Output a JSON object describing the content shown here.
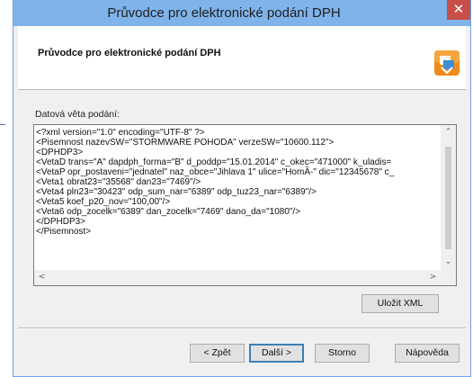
{
  "window": {
    "title": "Průvodce pro elektronické podání DPH",
    "close_glyph": "✕"
  },
  "header": {
    "title": "Průvodce pro elektronické podání DPH",
    "icon": "wizard-app-icon"
  },
  "section": {
    "label": "Datová věta podání:"
  },
  "xml_text": "<?xml version=\"1.0\" encoding=\"UTF-8\" ?>\n<Pisemnost nazevSW=\"STORMWARE POHODA\" verzeSW=\"10600.112\">\n<DPHDP3>\n<VetaD trans=\"A\" dapdph_forma=\"B\" d_poddp=\"15.01.2014\" c_okec=\"471000\" k_uladis=\n<VetaP opr_postaveni=\"jednatel\" naz_obce=\"Jihlava 1\" ulice=\"HomĂ-\" dic=\"12345678\" c_\n<Veta1 obrat23=\"35568\" dan23=\"7469\"/>\n<Veta4 pln23=\"30423\" odp_sum_nar=\"6389\" odp_tuz23_nar=\"6389\"/>\n<Veta5 koef_p20_nov=\"100,00\"/>\n<Veta6 odp_zocelk=\"6389\" dan_zocelk=\"7469\" dano_da=\"1080\"/>\n</DPHDP3>\n</Pisemnost>",
  "scroll": {
    "up": "⌃",
    "down": "⌄",
    "left": "<",
    "right": ">"
  },
  "buttons": {
    "save_xml": "Uložit XML",
    "back": "< Zpět",
    "next": "Další >",
    "cancel": "Storno",
    "help": "Nápověda"
  }
}
